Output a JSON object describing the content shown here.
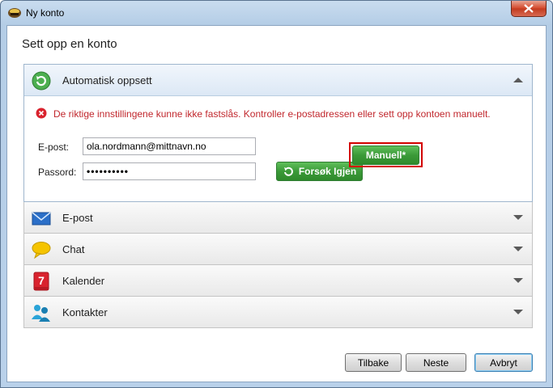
{
  "window": {
    "title": "Ny konto"
  },
  "page": {
    "title": "Sett opp en konto"
  },
  "auto_setup": {
    "label": "Automatisk oppsett",
    "error_message": "De riktige innstillingene kunne ikke fastslås. Kontroller e-postadressen eller sett opp kontoen manuelt.",
    "email_label": "E-post:",
    "email_value": "ola.nordmann@mittnavn.no",
    "password_label": "Passord:",
    "password_value": "••••••••••",
    "retry_label": "Forsøk Igjen",
    "manual_label": "Manuell*"
  },
  "sections": [
    {
      "label": "E-post",
      "icon": "envelope-icon"
    },
    {
      "label": "Chat",
      "icon": "chat-bubble-icon"
    },
    {
      "label": "Kalender",
      "icon": "calendar-icon",
      "icon_text": "7"
    },
    {
      "label": "Kontakter",
      "icon": "contacts-icon"
    }
  ],
  "footer": {
    "back_label": "Tilbake",
    "next_label": "Neste",
    "cancel_label": "Avbryt"
  },
  "colors": {
    "error": "#c1272d",
    "accent_green": "#3b9a38",
    "highlight_red": "#d40000"
  }
}
